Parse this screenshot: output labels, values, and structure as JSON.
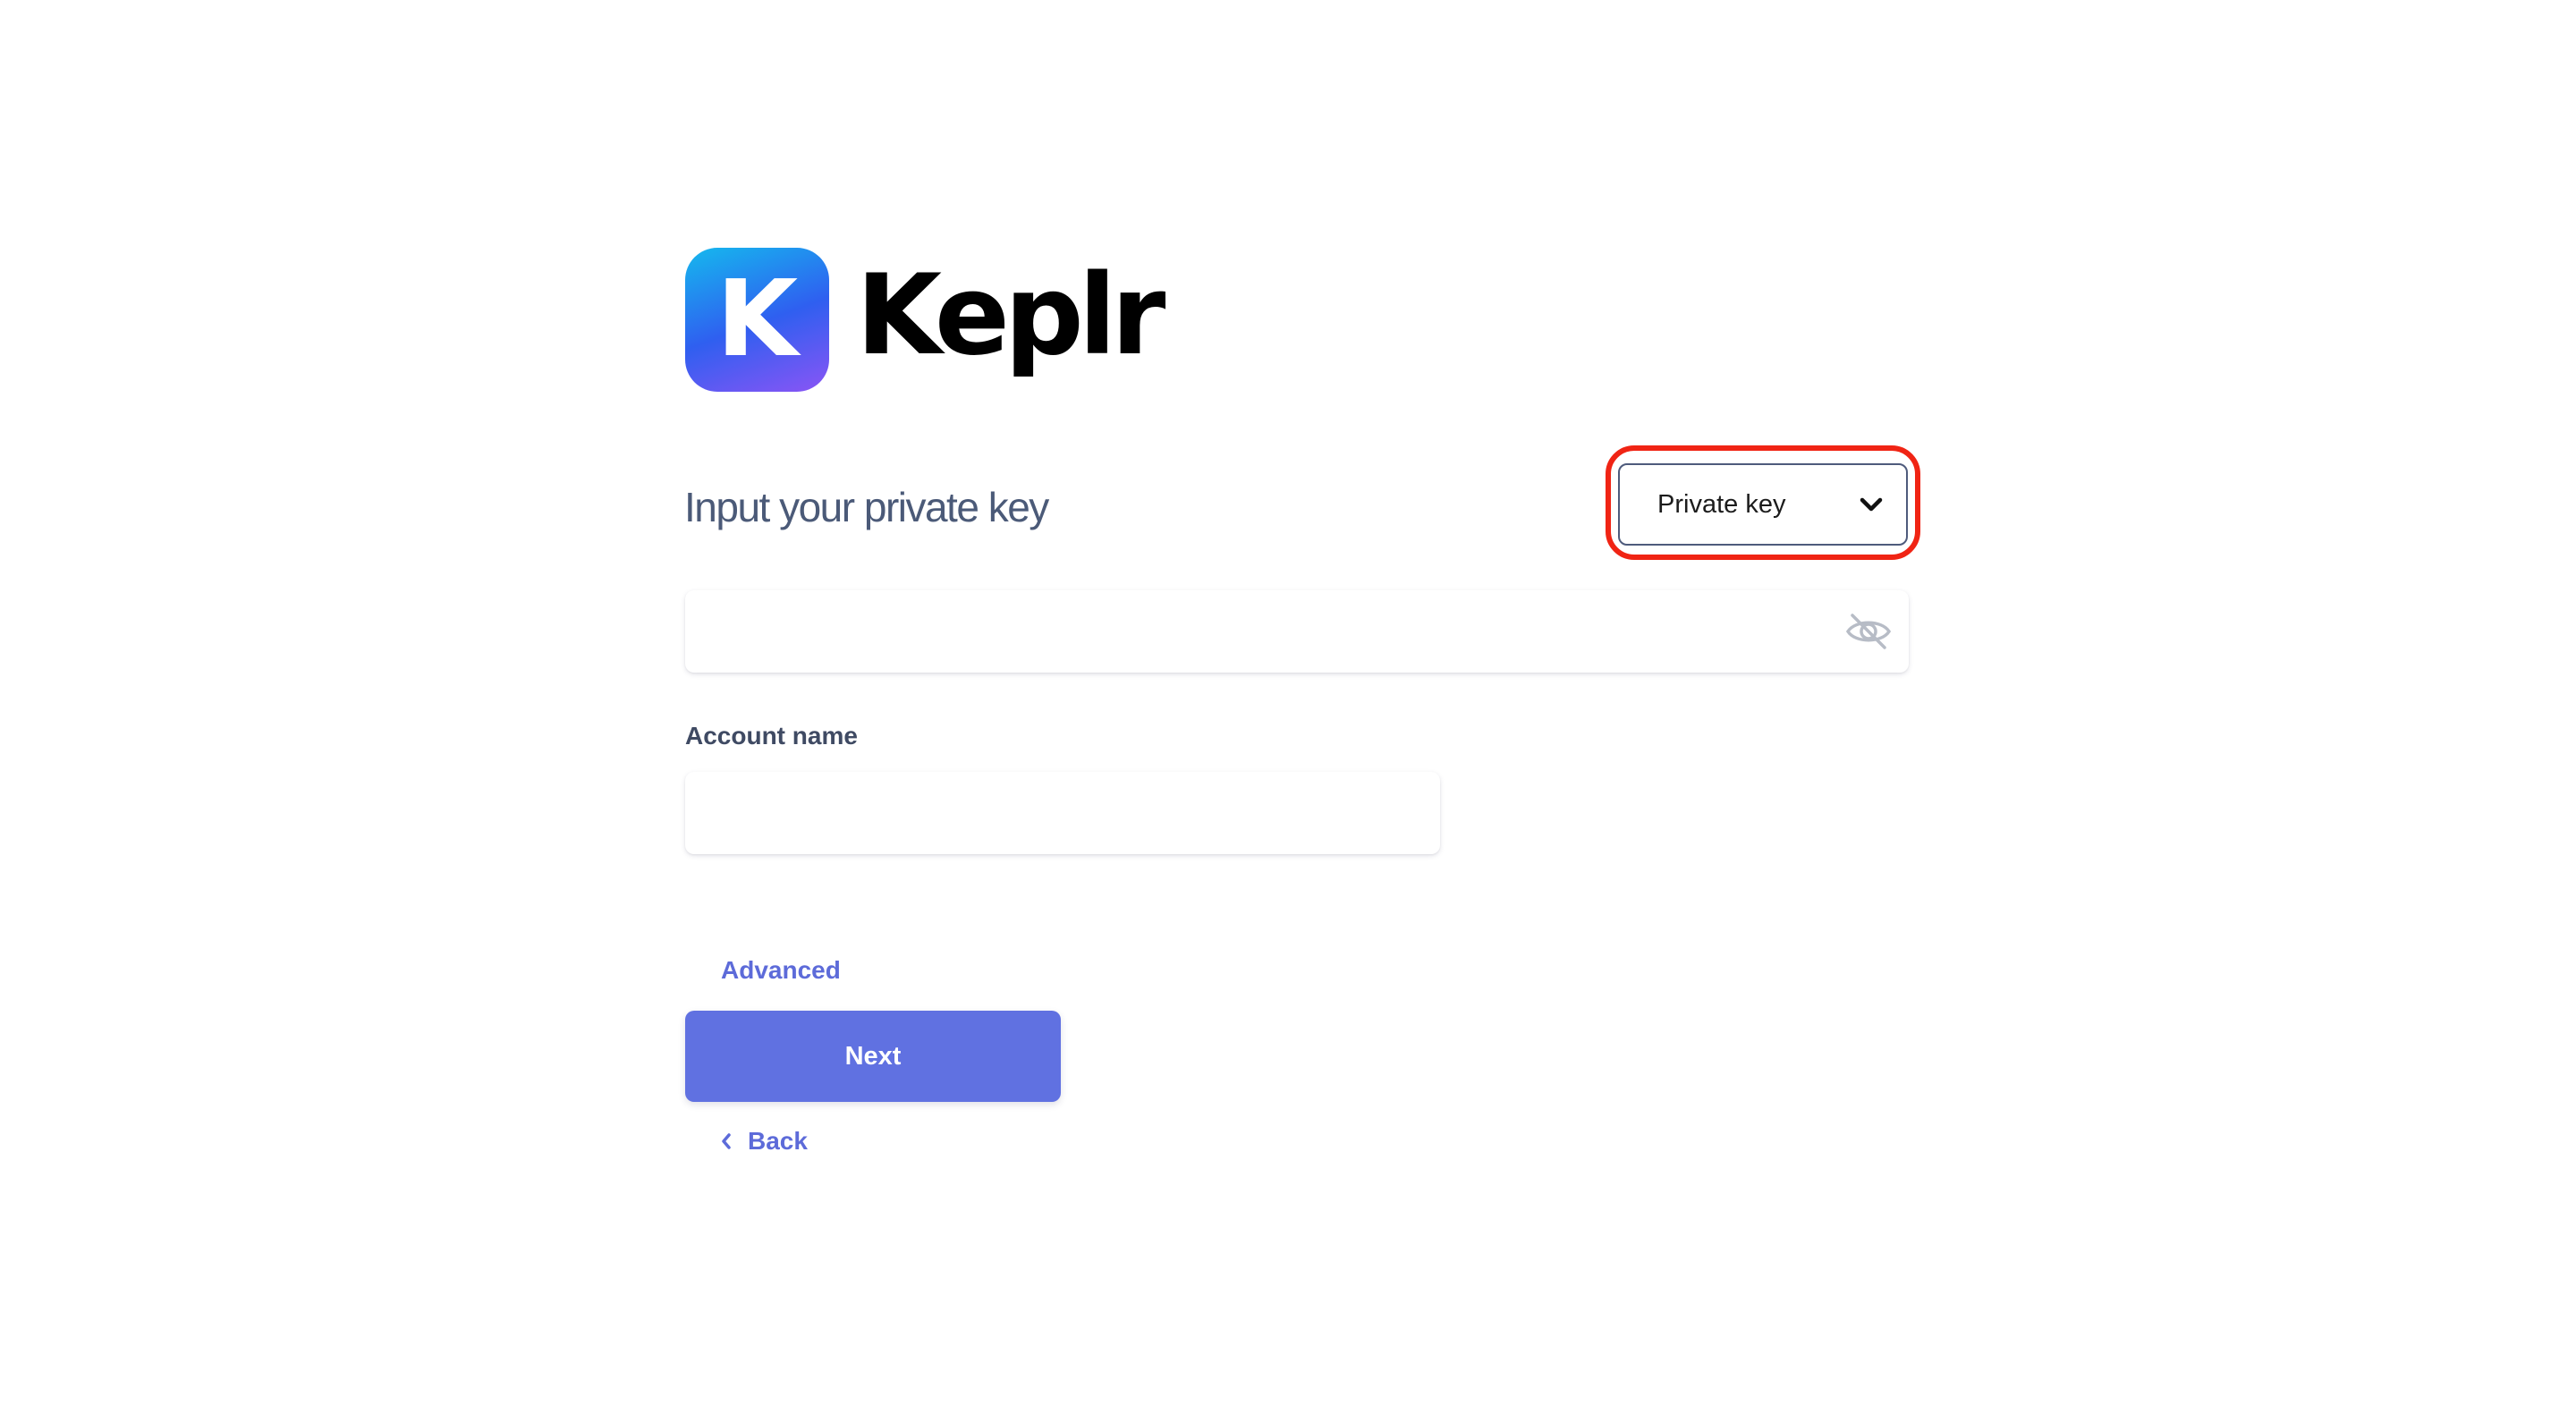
{
  "brand": {
    "logo_letter": "K",
    "name": "Keplr",
    "gradient": [
      "#15b9ee",
      "#2f5ff0",
      "#8a55f5"
    ]
  },
  "form": {
    "title": "Input your private key",
    "type_select": {
      "selected": "Private key",
      "icon": "chevron-down-icon"
    },
    "private_key_input": {
      "value": "",
      "placeholder": "",
      "visibility_icon": "eye-off-icon"
    },
    "account_name": {
      "label": "Account name",
      "value": "",
      "placeholder": ""
    },
    "advanced_label": "Advanced",
    "next_label": "Next",
    "back_label": "Back"
  },
  "colors": {
    "accent": "#6071e1",
    "link": "#5d6bd9",
    "highlight": "#f02414",
    "title": "#4b5a78"
  }
}
